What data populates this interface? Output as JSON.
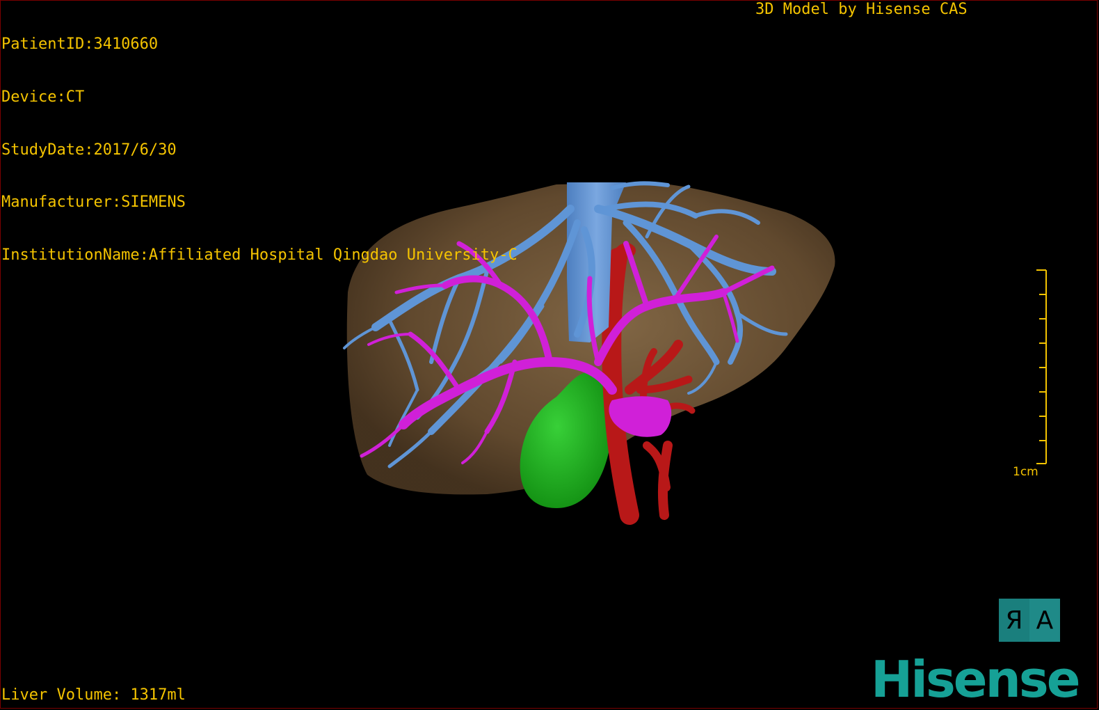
{
  "header": {
    "patient_id": "PatientID:3410660",
    "device": "Device:CT",
    "study_date": "StudyDate:2017/6/30",
    "manufacturer": "Manufacturer:SIEMENS",
    "institution": "InstitutionName:Affiliated Hospital Qingdao University-C"
  },
  "title": "3D Model by Hisense CAS",
  "liver_volume": "Liver Volume: 1317ml",
  "scale_bar": {
    "label": "1cm"
  },
  "orientation": {
    "left_glyph": "Я",
    "right_glyph": "A"
  },
  "logo_text": "Hisense",
  "colors": {
    "overlay_text": "#f5c400",
    "liver": "#8a6a44",
    "hepatic_vein": "#5f95d6",
    "portal_vein": "#d020d8",
    "artery": "#b81818",
    "gallbladder": "#1cae1c",
    "logo": "#16a196"
  }
}
